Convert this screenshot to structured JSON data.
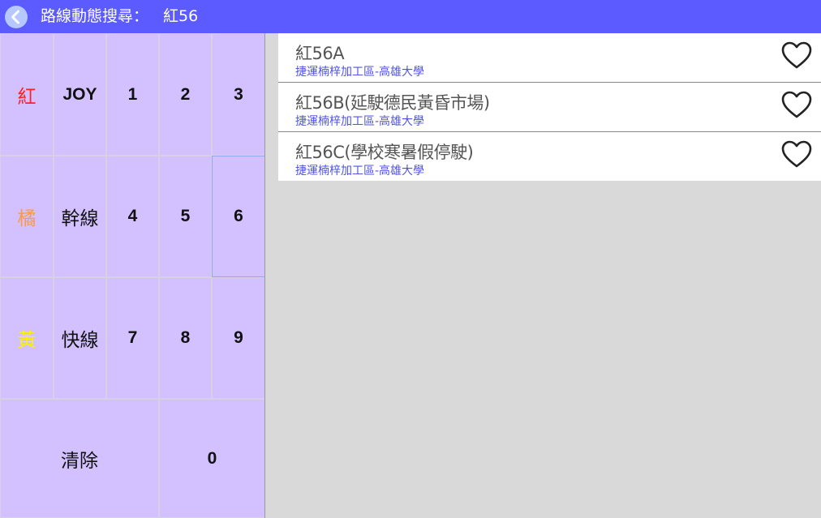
{
  "header": {
    "back_icon": "chevron-left-icon",
    "title": "路線動態搜尋：",
    "query": "紅56"
  },
  "keypad": {
    "keys": {
      "red": "紅",
      "joy": "JOY",
      "k1": "1",
      "k2": "2",
      "k3": "3",
      "orange": "橘",
      "trunk": "幹線",
      "k4": "4",
      "k5": "5",
      "k6": "6",
      "yellow": "黃",
      "express": "快線",
      "k7": "7",
      "k8": "8",
      "k9": "9",
      "clear": "清除",
      "k0": "0"
    },
    "colors": {
      "key_bg": "#d2c0ff",
      "red": "#ff2222",
      "orange": "#ff9a3c",
      "yellow": "#fff200"
    }
  },
  "routes": [
    {
      "name": "紅56A",
      "subtitle": "捷運楠梓加工區-高雄大學",
      "favorite_icon": "heart-outline-icon"
    },
    {
      "name": "紅56B(延駛德民黃昏市場)",
      "subtitle": "捷運楠梓加工區-高雄大學",
      "favorite_icon": "heart-outline-icon"
    },
    {
      "name": "紅56C(學校寒暑假停駛)",
      "subtitle": "捷運楠梓加工區-高雄大學",
      "favorite_icon": "heart-outline-icon"
    }
  ],
  "colors": {
    "header_bg": "#5b5bff",
    "subtitle": "#4f55e0",
    "background": "#d9d9d9"
  }
}
